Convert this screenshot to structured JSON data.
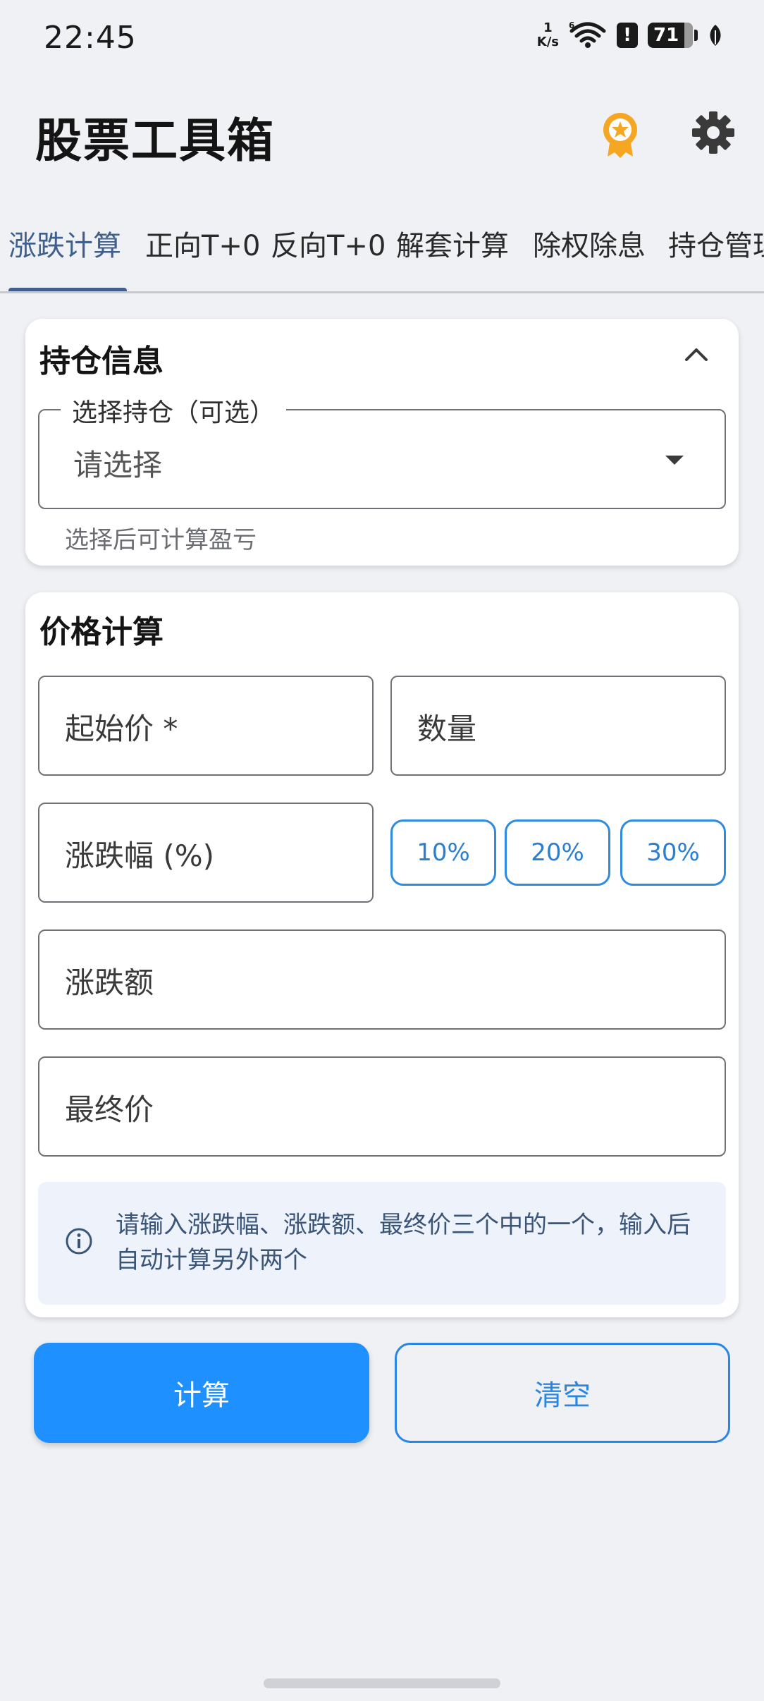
{
  "status_bar": {
    "time": "22:45",
    "net_speed_value": "1",
    "net_speed_unit": "K/s",
    "alert_glyph": "!",
    "battery": "71",
    "icons": [
      "wifi-6-icon",
      "alert-icon",
      "battery-icon",
      "leaf-icon"
    ]
  },
  "app_bar": {
    "title": "股票工具箱",
    "icons": [
      "medal-icon",
      "settings-icon"
    ],
    "medal_color": "#f5a623"
  },
  "tabs": [
    {
      "label": "涨跌计算",
      "active": true
    },
    {
      "label": "正向T+0"
    },
    {
      "label": "反向T+0"
    },
    {
      "label": "解套计算"
    },
    {
      "label": "除权除息"
    },
    {
      "label": "持仓管理"
    }
  ],
  "holding_card": {
    "title": "持仓信息",
    "select_label": "选择持仓（可选）",
    "select_placeholder": "请选择",
    "helper": "选择后可计算盈亏"
  },
  "price_card": {
    "title": "价格计算",
    "start_price_label": "起始价 *",
    "quantity_label": "数量",
    "change_pct_label": "涨跌幅 (%)",
    "chips": [
      "10%",
      "20%",
      "30%"
    ],
    "change_amount_label": "涨跌额",
    "final_price_label": "最终价",
    "info": "请输入涨跌幅、涨跌额、最终价三个中的一个，输入后自动计算另外两个"
  },
  "actions": {
    "calculate": "计算",
    "clear": "清空"
  },
  "colors": {
    "primary": "#1e90ff",
    "tab_active": "#3f5f8c",
    "background": "#eff1f5"
  }
}
